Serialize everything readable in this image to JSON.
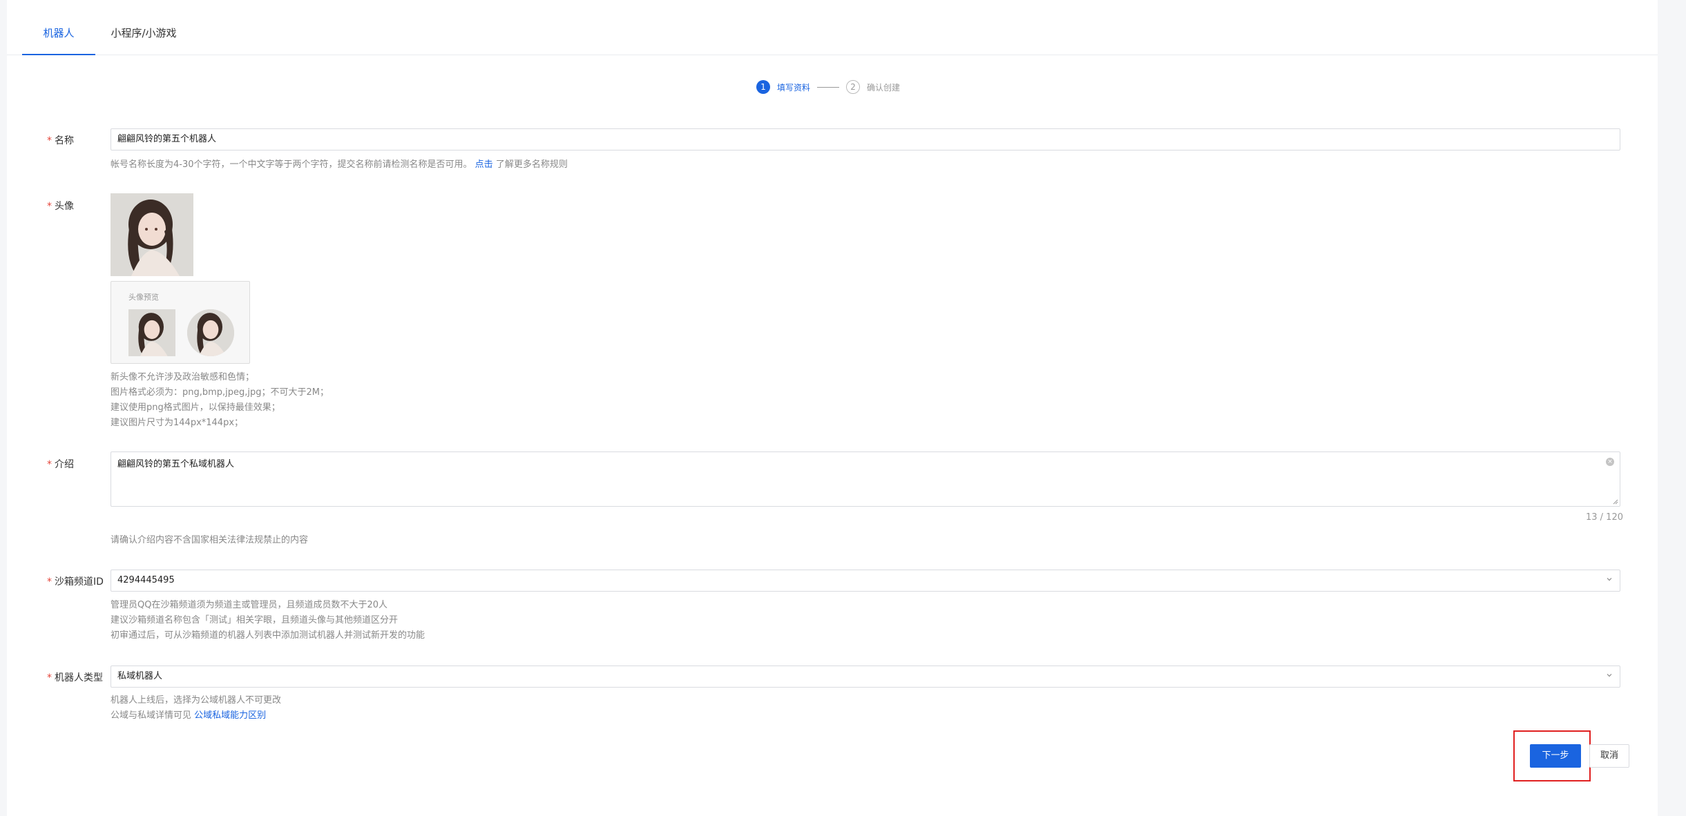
{
  "tabs": [
    {
      "label": "机器人",
      "active": true
    },
    {
      "label": "小程序/小游戏",
      "active": false
    }
  ],
  "steps": [
    {
      "num": "1",
      "label": "填写资料"
    },
    {
      "num": "2",
      "label": "确认创建"
    }
  ],
  "form": {
    "required_mark": "*",
    "name": {
      "label": "名称",
      "value": "翩翩风铃的第五个机器人",
      "hint_prefix": "帐号名称长度为4-30个字符，一个中文字等于两个字符，提交名称前请检测名称是否可用。",
      "hint_link": "点击",
      "hint_suffix": "了解更多名称规则"
    },
    "avatar": {
      "label": "头像",
      "preview_title": "头像预览",
      "hints": [
        "新头像不允许涉及政治敏感和色情；",
        "图片格式必须为：png,bmp,jpeg,jpg；不可大于2M；",
        "建议使用png格式图片，以保持最佳效果；",
        "建议图片尺寸为144px*144px；"
      ]
    },
    "intro": {
      "label": "介绍",
      "value": "翩翩风铃的第五个私域机器人",
      "counter": "13 / 120",
      "hint": "请确认介绍内容不含国家相关法律法规禁止的内容"
    },
    "sandbox": {
      "label": "沙箱频道ID",
      "value": "4294445495",
      "hints": [
        "管理员QQ在沙箱频道须为频道主或管理员，且频道成员数不大于20人",
        "建议沙箱频道名称包含「测试」相关字眼，且频道头像与其他频道区分开",
        "初审通过后，可从沙箱频道的机器人列表中添加测试机器人并测试新开发的功能"
      ]
    },
    "robot_type": {
      "label": "机器人类型",
      "value": "私域机器人",
      "hint1": "机器人上线后，选择为公域机器人不可更改",
      "hint2_prefix": "公域与私域详情可见",
      "hint2_link": "公域私域能力区别"
    }
  },
  "buttons": {
    "next": "下一步",
    "cancel": "取消"
  },
  "colors": {
    "accent": "#1a64e0",
    "required": "#e5463b",
    "highlight": "#e02020"
  }
}
